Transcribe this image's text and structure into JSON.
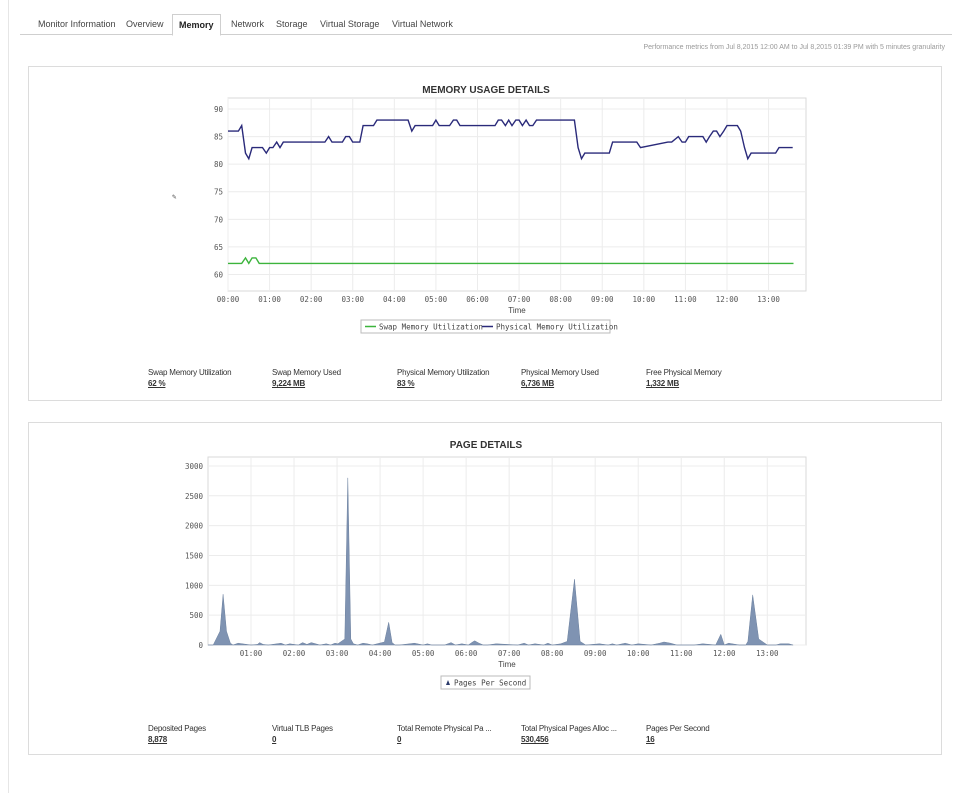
{
  "tabs": [
    {
      "label": "Monitor Information",
      "active": false
    },
    {
      "label": "Overview",
      "active": false
    },
    {
      "label": "Memory",
      "active": true
    },
    {
      "label": "Network",
      "active": false
    },
    {
      "label": "Storage",
      "active": false
    },
    {
      "label": "Virtual Storage",
      "active": false
    },
    {
      "label": "Virtual Network",
      "active": false
    }
  ],
  "performance_note": "Performance metrics from Jul 8,2015 12:00 AM to Jul 8,2015 01:39 PM with 5 minutes granularity",
  "memory_panel": {
    "stats": [
      {
        "label": "Swap Memory Utilization",
        "value": "62 %"
      },
      {
        "label": "Swap Memory Used",
        "value": "9,224 MB"
      },
      {
        "label": "Physical Memory Utilization",
        "value": "83 %"
      },
      {
        "label": "Physical Memory Used",
        "value": "6,736 MB"
      },
      {
        "label": "Free Physical Memory",
        "value": "1,332 MB"
      }
    ]
  },
  "page_panel": {
    "stats": [
      {
        "label": "Deposited Pages",
        "value": "8,878"
      },
      {
        "label": "Virtual TLB Pages",
        "value": "0"
      },
      {
        "label": "Total Remote Physical Pa ...",
        "value": "0"
      },
      {
        "label": "Total Physical Pages Alloc ...",
        "value": "530,456"
      },
      {
        "label": "Pages Per Second",
        "value": "16"
      }
    ]
  },
  "chart_data": [
    {
      "type": "line",
      "title": "MEMORY USAGE DETAILS",
      "xlabel": "Time",
      "ylabel": "",
      "ylim": [
        57,
        92
      ],
      "yticks": [
        60,
        65,
        70,
        75,
        80,
        85,
        90
      ],
      "xlim": [
        0,
        13.9
      ],
      "xticks": [
        "00:00",
        "01:00",
        "02:00",
        "03:00",
        "04:00",
        "05:00",
        "06:00",
        "07:00",
        "08:00",
        "09:00",
        "10:00",
        "11:00",
        "12:00",
        "13:00"
      ],
      "grid": true,
      "legend_position": "bottom",
      "series": [
        {
          "name": "Swap Memory Utilization",
          "color": "#3cb43c",
          "x": [
            0,
            0.33,
            0.42,
            0.5,
            0.58,
            0.67,
            0.75,
            13.6
          ],
          "y": [
            62,
            62,
            63,
            62,
            63,
            63,
            62,
            62
          ]
        },
        {
          "name": "Physical Memory Utilization",
          "color": "#2a2a7a",
          "x": [
            0,
            0.25,
            0.33,
            0.42,
            0.5,
            0.58,
            0.67,
            0.83,
            0.92,
            1.0,
            1.08,
            1.17,
            1.25,
            1.33,
            1.42,
            1.5,
            1.58,
            2.33,
            2.42,
            2.5,
            2.75,
            2.83,
            2.92,
            3.0,
            3.17,
            3.25,
            3.5,
            3.58,
            4.33,
            4.42,
            4.5,
            4.58,
            4.92,
            5.0,
            5.08,
            5.17,
            5.33,
            5.42,
            5.5,
            5.58,
            5.67,
            6.42,
            6.5,
            6.58,
            6.67,
            6.75,
            6.83,
            6.92,
            7.0,
            7.08,
            7.17,
            7.25,
            7.33,
            7.42,
            7.58,
            7.67,
            8.33,
            8.42,
            8.5,
            8.58,
            8.67,
            8.83,
            9.17,
            9.25,
            9.83,
            9.92,
            10.58,
            10.67,
            10.83,
            10.92,
            11.0,
            11.08,
            11.17,
            11.42,
            11.5,
            11.58,
            11.67,
            11.75,
            11.83,
            11.92,
            12.0,
            12.25,
            12.33,
            12.42,
            12.5,
            12.58,
            12.75,
            12.83,
            13.17,
            13.25,
            13.58
          ],
          "y": [
            86,
            86,
            87,
            82,
            81,
            83,
            83,
            83,
            82,
            83,
            83,
            84,
            83,
            84,
            84,
            84,
            84,
            84,
            85,
            84,
            84,
            85,
            85,
            84,
            84,
            87,
            87,
            88,
            88,
            86,
            87,
            87,
            87,
            88,
            87,
            87,
            87,
            88,
            88,
            87,
            87,
            87,
            88,
            88,
            87,
            88,
            87,
            88,
            88,
            87,
            88,
            87,
            87,
            88,
            88,
            88,
            88,
            83,
            81,
            82,
            82,
            82,
            82,
            84,
            84,
            83,
            84,
            84,
            85,
            84,
            84,
            85,
            85,
            85,
            84,
            85,
            86,
            86,
            85,
            86,
            87,
            87,
            86,
            83,
            81,
            82,
            82,
            82,
            82,
            83,
            83
          ]
        }
      ]
    },
    {
      "type": "area",
      "title": "PAGE DETAILS",
      "xlabel": "Time",
      "ylabel": "",
      "ylim": [
        0,
        3150
      ],
      "yticks": [
        0,
        500,
        1000,
        1500,
        2000,
        2500,
        3000
      ],
      "xlim": [
        0,
        13.9
      ],
      "xticks": [
        "01:00",
        "02:00",
        "03:00",
        "04:00",
        "05:00",
        "06:00",
        "07:00",
        "08:00",
        "09:00",
        "10:00",
        "11:00",
        "12:00",
        "13:00"
      ],
      "grid": true,
      "legend_position": "bottom",
      "series": [
        {
          "name": "Pages Per Second",
          "color": "#7f93b2",
          "x": [
            0.0,
            0.12,
            0.28,
            0.35,
            0.43,
            0.52,
            0.58,
            0.7,
            1.0,
            1.15,
            1.2,
            1.28,
            1.4,
            1.7,
            1.8,
            1.9,
            2.1,
            2.2,
            2.3,
            2.4,
            2.6,
            2.75,
            2.85,
            2.95,
            3.02,
            3.18,
            3.25,
            3.32,
            3.38,
            3.48,
            3.6,
            3.7,
            3.82,
            4.1,
            4.2,
            4.28,
            4.35,
            4.45,
            4.8,
            5.0,
            5.1,
            5.2,
            5.5,
            5.65,
            5.75,
            5.9,
            6.05,
            6.15,
            6.2,
            6.3,
            6.4,
            6.5,
            6.7,
            7.2,
            7.35,
            7.45,
            7.6,
            7.8,
            7.9,
            8.0,
            8.2,
            8.35,
            8.52,
            8.65,
            8.78,
            9.1,
            9.3,
            9.4,
            9.5,
            9.7,
            9.85,
            10.0,
            10.3,
            10.5,
            10.6,
            10.75,
            10.9,
            11.3,
            11.5,
            11.8,
            11.92,
            12.0,
            12.1,
            12.35,
            12.5,
            12.55,
            12.66,
            12.8,
            13.0,
            13.2,
            13.3,
            13.5,
            13.6
          ],
          "y": [
            0,
            0,
            230,
            850,
            230,
            30,
            0,
            30,
            0,
            10,
            40,
            10,
            0,
            30,
            0,
            20,
            0,
            40,
            10,
            40,
            0,
            20,
            0,
            30,
            20,
            100,
            2800,
            100,
            20,
            0,
            30,
            20,
            0,
            50,
            380,
            40,
            0,
            0,
            30,
            0,
            20,
            0,
            0,
            40,
            0,
            20,
            0,
            50,
            70,
            30,
            0,
            0,
            20,
            0,
            30,
            0,
            20,
            0,
            30,
            0,
            20,
            60,
            1100,
            60,
            0,
            20,
            0,
            20,
            0,
            30,
            0,
            20,
            0,
            30,
            50,
            30,
            0,
            0,
            20,
            0,
            180,
            0,
            30,
            0,
            0,
            60,
            840,
            100,
            0,
            0,
            20,
            20,
            0
          ]
        }
      ]
    }
  ]
}
